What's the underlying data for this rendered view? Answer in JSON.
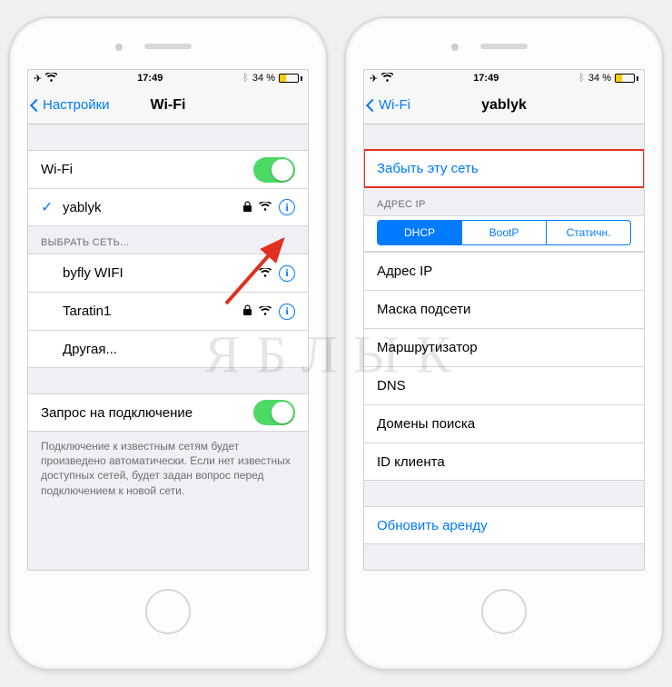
{
  "status": {
    "time": "17:49",
    "battery_pct": "34 %",
    "battery_fill_color": "#ffcc00"
  },
  "phone_left": {
    "back_label": "Настройки",
    "title": "Wi-Fi",
    "wifi_toggle_label": "Wi-Fi",
    "connected": {
      "name": "yablyk",
      "locked": true
    },
    "choose_header": "ВЫБРАТЬ СЕТЬ...",
    "networks": [
      {
        "name": "byfly WIFI",
        "locked": false
      },
      {
        "name": "Taratin1",
        "locked": true
      }
    ],
    "other_label": "Другая...",
    "ask_label": "Запрос на подключение",
    "ask_footer": "Подключение к известным сетям будет произведено автоматически. Если нет известных доступных сетей, будет задан вопрос перед подключением к новой сети."
  },
  "phone_right": {
    "back_label": "Wi-Fi",
    "title": "yablyk",
    "forget_label": "Забыть эту сеть",
    "ip_header": "АДРЕС IP",
    "segments": [
      "DHCP",
      "BootP",
      "Статичн."
    ],
    "active_segment": 0,
    "fields": [
      "Адрес IP",
      "Маска подсети",
      "Маршрутизатор",
      "DNS",
      "Домены поиска",
      "ID клиента"
    ],
    "renew_label": "Обновить аренду"
  },
  "watermark_text": "ЯБЛЫК",
  "colors": {
    "tint": "#007aff",
    "toggle_on": "#4cd964",
    "highlight": "#e0311f"
  }
}
